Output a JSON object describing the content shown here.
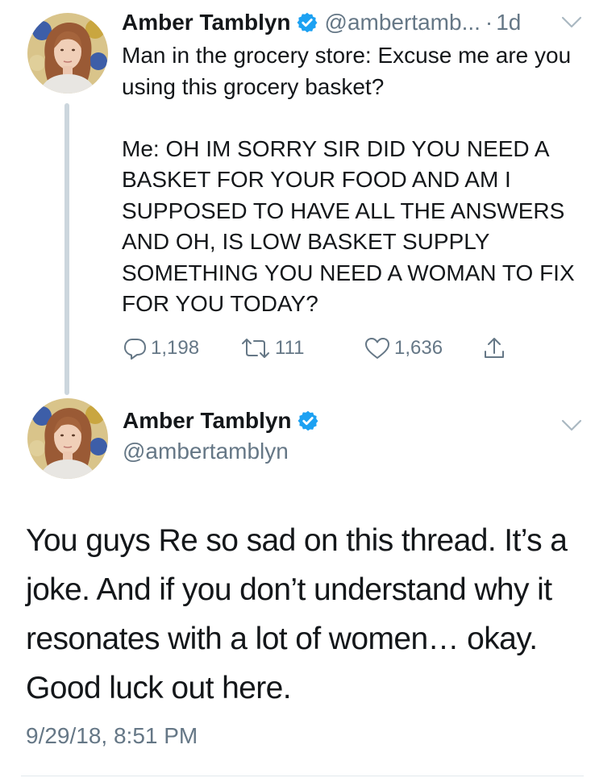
{
  "reply_tweet": {
    "author_name": "Amber Tamblyn",
    "handle": "@ambertamb...",
    "separator": "·",
    "age": "1d",
    "text": "Man in the grocery store: Excuse me are you using this grocery basket?\n\nMe: OH IM SORRY SIR DID YOU NEED A BASKET FOR YOUR FOOD AND AM I SUPPOSED TO HAVE ALL THE ANSWERS AND OH, IS LOW BASKET SUPPLY SOMETHING YOU NEED A WOMAN TO FIX FOR YOU TODAY?",
    "actions": {
      "reply_count": "1,198",
      "retweet_count": "111",
      "like_count": "1,636"
    }
  },
  "main_tweet": {
    "author_name": "Amber Tamblyn",
    "handle": "@ambertamblyn",
    "text": "You guys Re so sad on this thread. It’s a joke. And if you don’t understand why it resonates with a lot of women… okay. Good luck out here.",
    "timestamp": "9/29/18, 8:51 PM"
  },
  "colors": {
    "text_primary": "#14171a",
    "text_secondary": "#657786",
    "verified_blue": "#1da1f2",
    "thread_line": "#ccd6dd",
    "divider": "#e1e8ed"
  },
  "icons": {
    "verified": "verified-badge-icon",
    "reply": "reply-bubble-icon",
    "retweet": "retweet-icon",
    "like": "heart-icon",
    "share": "share-icon",
    "menu": "chevron-down-icon"
  }
}
